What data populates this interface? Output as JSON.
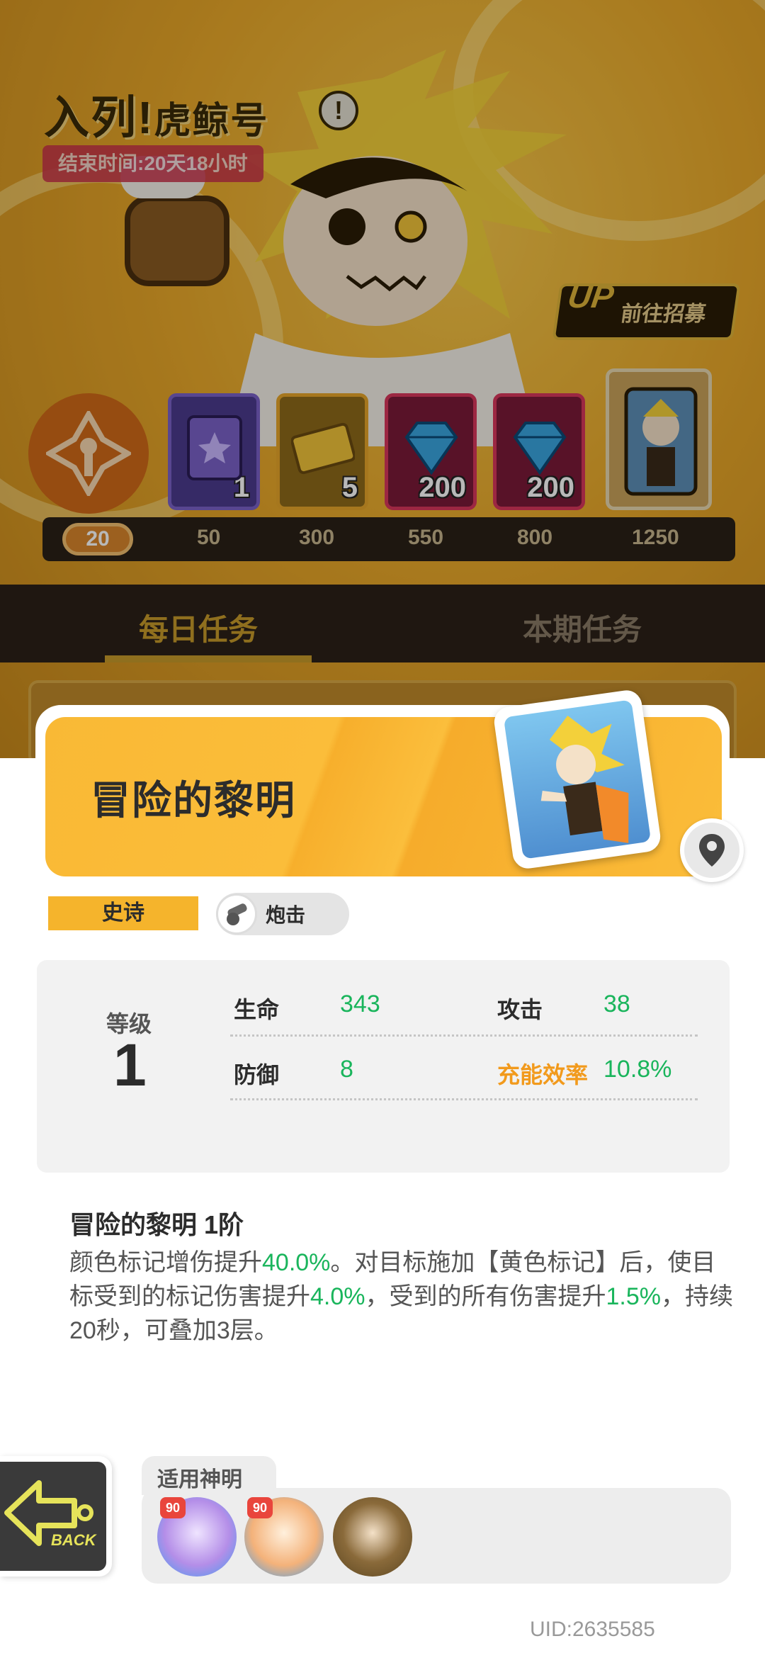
{
  "banner": {
    "title_main": "入列!",
    "title_sub": "虎鲸号",
    "info_glyph": "!",
    "end_time": "结束时间:20天18小时",
    "recruit_up": "UP",
    "recruit_label": "前往招募",
    "current_points": "20",
    "rewards": [
      {
        "amount": "1",
        "icon": "card-pack-icon"
      },
      {
        "amount": "5",
        "icon": "ticket-icon"
      },
      {
        "amount": "200",
        "icon": "diamond-icon"
      },
      {
        "amount": "200",
        "icon": "diamond-icon"
      },
      {
        "amount": "",
        "icon": "character-card-icon"
      }
    ],
    "milestones": [
      "50",
      "300",
      "550",
      "800",
      "1250"
    ]
  },
  "tabs": {
    "daily": "每日任务",
    "period": "本期任务"
  },
  "card": {
    "name": "冒险的黎明",
    "rarity": "史诗",
    "type": "炮击",
    "type_icon": "cannon-icon",
    "location_icon": "location-pin-icon",
    "level_label": "等级",
    "level": "1",
    "stats": {
      "hp_label": "生命",
      "hp": "343",
      "atk_label": "攻击",
      "atk": "38",
      "def_label": "防御",
      "def": "8",
      "energy_label": "充能效率",
      "energy": "10.8%"
    },
    "skill_title": "冒险的黎明 1阶",
    "skill_desc": {
      "p1": "颜色标记增伤提升",
      "v1": "40.0%",
      "p2": "。对目标施加【黄色标记】后，使目标受到的标记伤害提升",
      "v2": "4.0%",
      "p3": "，受到的所有伤害提升",
      "v3": "1.5%",
      "p4": "，持续20秒，可叠加3层。"
    }
  },
  "footer": {
    "back_label": "BACK",
    "gods_label": "适用神明",
    "gods": [
      {
        "level": "90",
        "name": "god-purple-avatar"
      },
      {
        "level": "90",
        "name": "god-orange-avatar"
      },
      {
        "level": "",
        "name": "god-dark-avatar"
      }
    ],
    "uid": "UID:2635585"
  },
  "colors": {
    "accent": "#f5b42c",
    "stat_value": "#1ab55c",
    "energy_label": "#f29a1c"
  }
}
